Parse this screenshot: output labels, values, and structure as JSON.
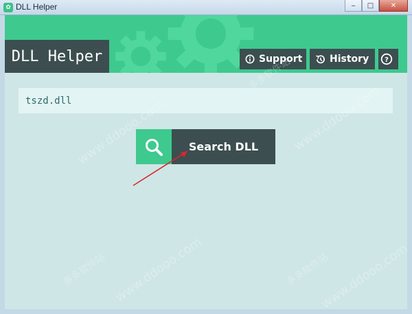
{
  "window": {
    "title": "DLL Helper",
    "app_icon_glyph": "✿",
    "buttons": {
      "minimize": "‒",
      "maximize": "□",
      "close": "✕"
    }
  },
  "header": {
    "logo": "DLL Helper",
    "support_label": "Support",
    "history_label": "History",
    "help_glyph": "?"
  },
  "search": {
    "value": "tszd.dll",
    "button_label": "Search DLL"
  },
  "colors": {
    "accent_green": "#3ec98f",
    "dark_slate": "#3c4e50",
    "background": "#cfe6e6",
    "input_bg": "#e2f4f3",
    "arrow_red": "#d8282a"
  },
  "watermark": {
    "domain": "www.ddooo.com",
    "cn_site": "多多软件站"
  }
}
